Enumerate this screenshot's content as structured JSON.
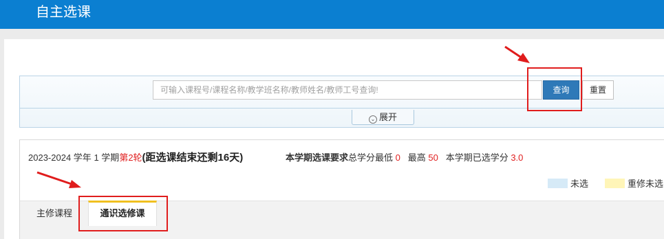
{
  "header": {
    "title": "自主选课"
  },
  "search": {
    "placeholder": "可输入课程号/课程名称/教学班名称/教师姓名/教师工号查询!",
    "value": "",
    "query_label": "查询",
    "reset_label": "重置",
    "expand_label": "展开"
  },
  "term": {
    "year": "2023-2024",
    "year_unit": "学年",
    "semester": "1",
    "semester_unit": "学期",
    "round": "第2轮",
    "countdown_open": "(",
    "countdown": "距选课结束还剩16天",
    "countdown_close": ")"
  },
  "requirements": {
    "label": "本学期选课要求",
    "min_label": "总学分最低",
    "min_value": "0",
    "max_label": "最高",
    "max_value": "50",
    "selected_label": "本学期已选学分",
    "selected_value": "3.0"
  },
  "legend": [
    {
      "label": "未选",
      "color": "#d6eaf7"
    },
    {
      "label": "重修未选",
      "color": "#fff5b8"
    }
  ],
  "tabs": [
    {
      "label": "主修课程"
    },
    {
      "label": "通识选修课"
    }
  ],
  "colors": {
    "header_bg": "#0b7fd1",
    "primary_button": "#2f79b8",
    "highlight_red": "#e01c1c",
    "active_tab_accent": "#f0c020"
  }
}
